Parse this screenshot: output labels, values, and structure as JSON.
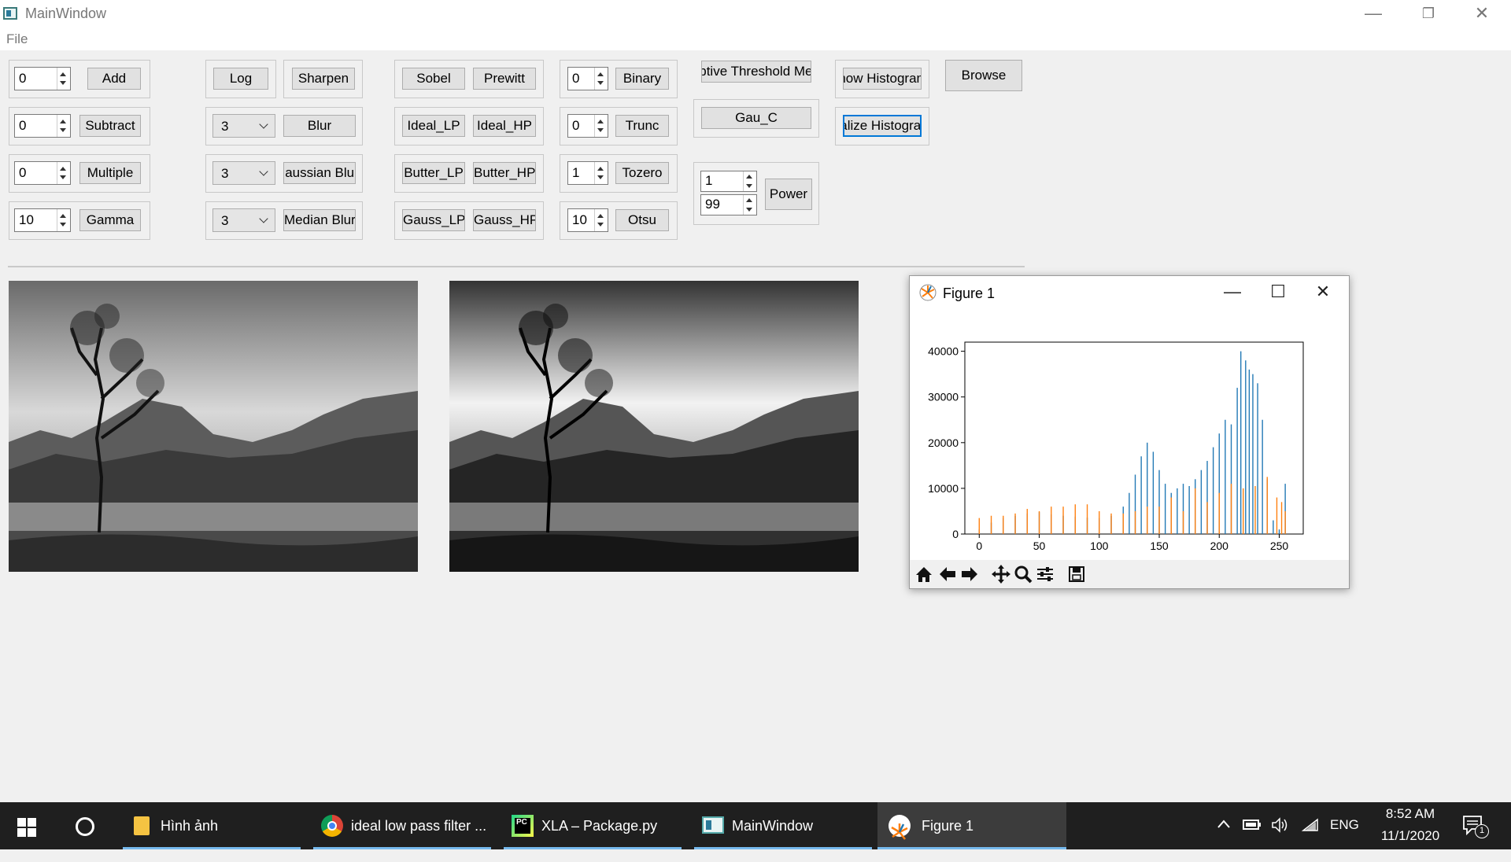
{
  "window": {
    "title": "MainWindow",
    "minimize": "—",
    "restore": "❐",
    "close": "✕",
    "menu": [
      "File"
    ]
  },
  "arith": {
    "add_val": "0",
    "add_label": "Add",
    "sub_val": "0",
    "sub_label": "Subtract",
    "mul_val": "0",
    "mul_label": "Multiple",
    "gamma_val": "10",
    "gamma_label": "Gamma"
  },
  "filters": {
    "log_label": "Log",
    "sharpen_label": "Sharpen",
    "blur_ksize": "3",
    "blur_label": "Blur",
    "gauss_ksize": "3",
    "gauss_label": "Gaussian Blur",
    "median_ksize": "3",
    "median_label": "Median Blur"
  },
  "freq": {
    "sobel": "Sobel",
    "prewitt": "Prewitt",
    "ideal_lp": "Ideal_LP",
    "ideal_hp": "Ideal_HP",
    "butter_lp": "Butter_LP",
    "butter_hp": "Butter_HP",
    "gauss_lp": "Gauss_LP",
    "gauss_hp": "Gauss_HP"
  },
  "threshold": {
    "binary_val": "0",
    "binary_label": "Binary",
    "trunc_val": "0",
    "trunc_label": "Trunc",
    "tozero_val": "1",
    "tozero_label": "Tozero",
    "otsu_val": "10",
    "otsu_label": "Otsu"
  },
  "adaptive": {
    "mean_label": "Adaptive Threshold Mean",
    "gau_label": "Gau_C",
    "power_c": "1",
    "power_gamma": "99",
    "power_label": "Power"
  },
  "histogram": {
    "show_label": "Show Histogram",
    "equalize_label": "Equalize Histogram"
  },
  "browse_label": "Browse",
  "figure": {
    "title": "Figure 1",
    "min": "—",
    "max": "☐",
    "close": "✕"
  },
  "chart_data": {
    "type": "bar",
    "title": "",
    "xlabel": "",
    "ylabel": "",
    "xlim": [
      -12,
      270
    ],
    "ylim": [
      0,
      42000
    ],
    "xticks": [
      0,
      50,
      100,
      150,
      200,
      250
    ],
    "yticks": [
      0,
      10000,
      20000,
      30000,
      40000
    ],
    "x_tick_labels": [
      "0",
      "50",
      "100",
      "150",
      "200",
      "250"
    ],
    "y_tick_labels": [
      "0",
      "10000",
      "20000",
      "30000",
      "40000"
    ],
    "grid": false,
    "series": [
      {
        "name": "",
        "color": "#1f77b4",
        "points": [
          [
            0,
            1000
          ],
          [
            10,
            2500
          ],
          [
            20,
            3500
          ],
          [
            30,
            4000
          ],
          [
            40,
            4500
          ],
          [
            50,
            4800
          ],
          [
            60,
            4300
          ],
          [
            70,
            4000
          ],
          [
            80,
            3800
          ],
          [
            90,
            3600
          ],
          [
            100,
            3500
          ],
          [
            110,
            4000
          ],
          [
            120,
            6000
          ],
          [
            125,
            9000
          ],
          [
            130,
            13000
          ],
          [
            135,
            17000
          ],
          [
            140,
            20000
          ],
          [
            145,
            18000
          ],
          [
            150,
            14000
          ],
          [
            155,
            11000
          ],
          [
            160,
            9000
          ],
          [
            165,
            10000
          ],
          [
            170,
            11000
          ],
          [
            175,
            10500
          ],
          [
            180,
            12000
          ],
          [
            185,
            14000
          ],
          [
            190,
            16000
          ],
          [
            195,
            19000
          ],
          [
            200,
            22000
          ],
          [
            205,
            25000
          ],
          [
            210,
            24000
          ],
          [
            215,
            32000
          ],
          [
            218,
            40000
          ],
          [
            222,
            38000
          ],
          [
            225,
            36000
          ],
          [
            228,
            35000
          ],
          [
            232,
            33000
          ],
          [
            236,
            25000
          ],
          [
            240,
            12000
          ],
          [
            245,
            3000
          ],
          [
            250,
            1000
          ],
          [
            255,
            11000
          ]
        ]
      },
      {
        "name": "",
        "color": "#ff7f0e",
        "points": [
          [
            0,
            3500
          ],
          [
            10,
            4000
          ],
          [
            20,
            4000
          ],
          [
            30,
            4500
          ],
          [
            40,
            5500
          ],
          [
            50,
            5000
          ],
          [
            60,
            6000
          ],
          [
            70,
            6000
          ],
          [
            80,
            6500
          ],
          [
            90,
            6500
          ],
          [
            100,
            5000
          ],
          [
            110,
            4500
          ],
          [
            120,
            4500
          ],
          [
            130,
            5000
          ],
          [
            140,
            6000
          ],
          [
            150,
            6000
          ],
          [
            160,
            8000
          ],
          [
            170,
            5000
          ],
          [
            180,
            10000
          ],
          [
            190,
            7000
          ],
          [
            200,
            9000
          ],
          [
            210,
            11000
          ],
          [
            220,
            10000
          ],
          [
            230,
            10500
          ],
          [
            240,
            12500
          ],
          [
            248,
            8000
          ],
          [
            252,
            7000
          ],
          [
            255,
            5000
          ]
        ]
      }
    ]
  },
  "taskbar": {
    "explorer": "Hình ảnh",
    "chrome": "ideal low pass filter ...",
    "pycharm": "XLA – Package.py",
    "mainwindow": "MainWindow",
    "figure": "Figure 1",
    "lang": "ENG",
    "time": "8:52 AM",
    "date": "11/1/2020",
    "notif_count": "1"
  }
}
